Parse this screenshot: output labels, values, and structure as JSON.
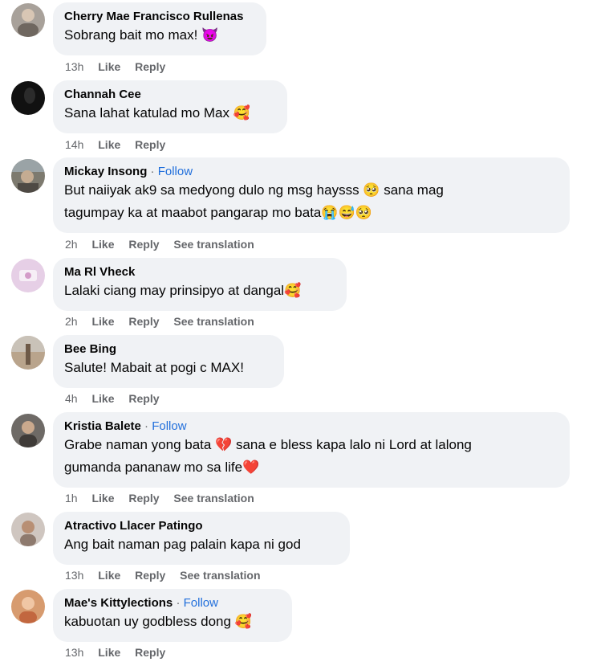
{
  "comments": [
    {
      "name": "Cherry Mae Francisco Rullenas",
      "follow": "",
      "lines": [
        "Sobrang bait mo max! 😈"
      ],
      "time": "13h",
      "like": "Like",
      "reply": "Reply",
      "translation": "",
      "avatar_color": "#a8a19a"
    },
    {
      "name": "Channah Cee",
      "follow": "",
      "lines": [
        "Sana lahat katulad mo Max 🥰"
      ],
      "time": "14h",
      "like": "Like",
      "reply": "Reply",
      "translation": "",
      "avatar_color": "#111111"
    },
    {
      "name": "Mickay Insong",
      "follow": "Follow",
      "lines": [
        "But naiiyak ak9 sa medyong dulo ng msg haysss 🥺 sana mag",
        "tagumpay ka at maabot pangarap mo bata😭😅🥺"
      ],
      "time": "2h",
      "like": "Like",
      "reply": "Reply",
      "translation": "See translation",
      "avatar_color": "#7d7a6f"
    },
    {
      "name": "Ma Rl Vheck",
      "follow": "",
      "lines": [
        "Lalaki ciang may prinsipyo at dangal🥰"
      ],
      "time": "2h",
      "like": "Like",
      "reply": "Reply",
      "translation": "See translation",
      "avatar_color": "#e6cfe6"
    },
    {
      "name": "Bee Bing",
      "follow": "",
      "lines": [
        "Salute! Mabait at pogi c MAX!"
      ],
      "time": "4h",
      "like": "Like",
      "reply": "Reply",
      "translation": "",
      "avatar_color": "#b9a48c"
    },
    {
      "name": "Kristia Balete",
      "follow": "Follow",
      "lines": [
        "Grabe naman yong bata 💔 sana e bless kapa lalo ni Lord at lalong",
        "gumanda pananaw mo sa life❤️"
      ],
      "time": "1h",
      "like": "Like",
      "reply": "Reply",
      "translation": "See translation",
      "avatar_color": "#6e6a66"
    },
    {
      "name": "Atractivo Llacer Patingo",
      "follow": "",
      "lines": [
        "Ang bait naman pag palain kapa ni god"
      ],
      "time": "13h",
      "like": "Like",
      "reply": "Reply",
      "translation": "See translation",
      "avatar_color": "#cfc6c0"
    },
    {
      "name": "Mae's Kittylections",
      "follow": "Follow",
      "lines": [
        "kabuotan uy godbless dong 🥰"
      ],
      "time": "13h",
      "like": "Like",
      "reply": "Reply",
      "translation": "",
      "avatar_color": "#d79b6f"
    }
  ],
  "follow_dot": "·"
}
